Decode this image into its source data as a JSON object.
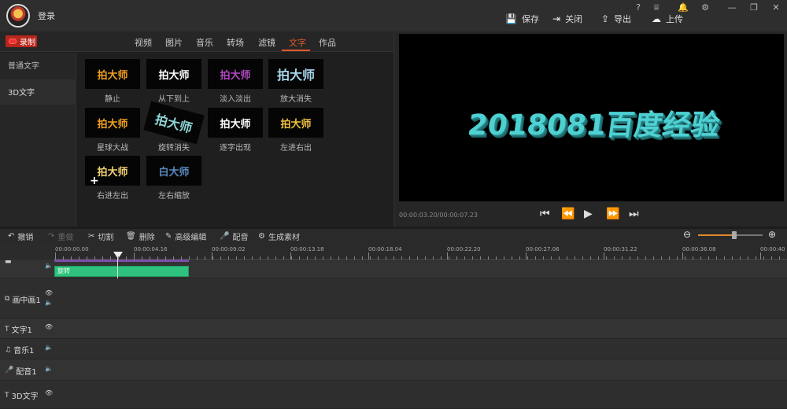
{
  "titlebar": {
    "login_label": "登录",
    "window_controls": [
      "?",
      "♕",
      "🔔",
      "⚙",
      "—",
      "❐",
      "✕"
    ],
    "actions": [
      {
        "icon": "save-icon",
        "glyph": "💾",
        "label": "保存"
      },
      {
        "icon": "exit-icon",
        "glyph": "⇥",
        "label": "关闭"
      },
      {
        "icon": "export-icon",
        "glyph": "⇪",
        "label": "导出"
      },
      {
        "icon": "upload-icon",
        "glyph": "☁",
        "label": "上传"
      }
    ]
  },
  "record_label": "录制",
  "tabs": [
    "视频",
    "图片",
    "音乐",
    "转场",
    "滤镜",
    "文字",
    "作品"
  ],
  "active_tab": "文字",
  "categories": [
    "普通文字",
    "3D文字"
  ],
  "selected_category": "3D文字",
  "effects": [
    {
      "text": "拍大师",
      "label": "静止",
      "color": "#f0a020"
    },
    {
      "text": "拍大师",
      "label": "从下到上",
      "color": "#ffffff"
    },
    {
      "text": "拍大师",
      "label": "淡入淡出",
      "color": "#b04ac0"
    },
    {
      "text": "拍大师",
      "label": "放大消失",
      "color": "#a9d6ec"
    },
    {
      "text": "拍大师",
      "label": "星球大战",
      "color": "#f0a020"
    },
    {
      "text": "拍大师",
      "label": "旋转消失",
      "color": "#8fd6d6"
    },
    {
      "text": "拍大师",
      "label": "逐字出现",
      "color": "#ffffff"
    },
    {
      "text": "拍大师",
      "label": "左进右出",
      "color": "#f0c040"
    },
    {
      "text": "拍大师",
      "label": "右进左出",
      "color": "#f0d070"
    },
    {
      "text": "白大师",
      "label": "左右缩放",
      "color": "#5a8ac0"
    }
  ],
  "preview": {
    "text": "2018081百度经验",
    "timecode": "00:00:03.20/00:00:07.23"
  },
  "edit_toolbar": [
    {
      "icon": "undo-icon",
      "glyph": "↶",
      "label": "撤销",
      "enabled": true
    },
    {
      "icon": "redo-icon",
      "glyph": "↷",
      "label": "重做",
      "enabled": false
    },
    {
      "icon": "scissors-icon",
      "glyph": "✂",
      "label": "切割",
      "enabled": true
    },
    {
      "icon": "trash-icon",
      "glyph": "🗑",
      "label": "删除",
      "enabled": true
    },
    {
      "icon": "pen-icon",
      "glyph": "✎",
      "label": "高级编辑",
      "enabled": true
    },
    {
      "icon": "mic-icon",
      "glyph": "🎤",
      "label": "配音",
      "enabled": true
    },
    {
      "icon": "gear-icon",
      "glyph": "⚙",
      "label": "生成素材",
      "enabled": true
    }
  ],
  "zoom_level": 0.56,
  "ruler_labels": [
    "00:00:00.00",
    "00:00:04.16",
    "00:00:09.02",
    "00:00:13.18",
    "00:00:18.04",
    "00:00:22.20",
    "00:00:27.06",
    "00:00:31.22",
    "00:00:36.08",
    "00:00:40"
  ],
  "tracks": [
    {
      "name": "画中画1",
      "icon": "pip-icon",
      "glyph": "⧉"
    },
    {
      "name": "文字1",
      "icon": "text-icon",
      "glyph": "T"
    },
    {
      "name": "音乐1",
      "icon": "music-icon",
      "glyph": "♫"
    },
    {
      "name": "配音1",
      "icon": "mic-icon",
      "glyph": "🎤"
    },
    {
      "name": "3D文字",
      "icon": "text-icon",
      "glyph": "T"
    }
  ],
  "clip_label": "旋转"
}
